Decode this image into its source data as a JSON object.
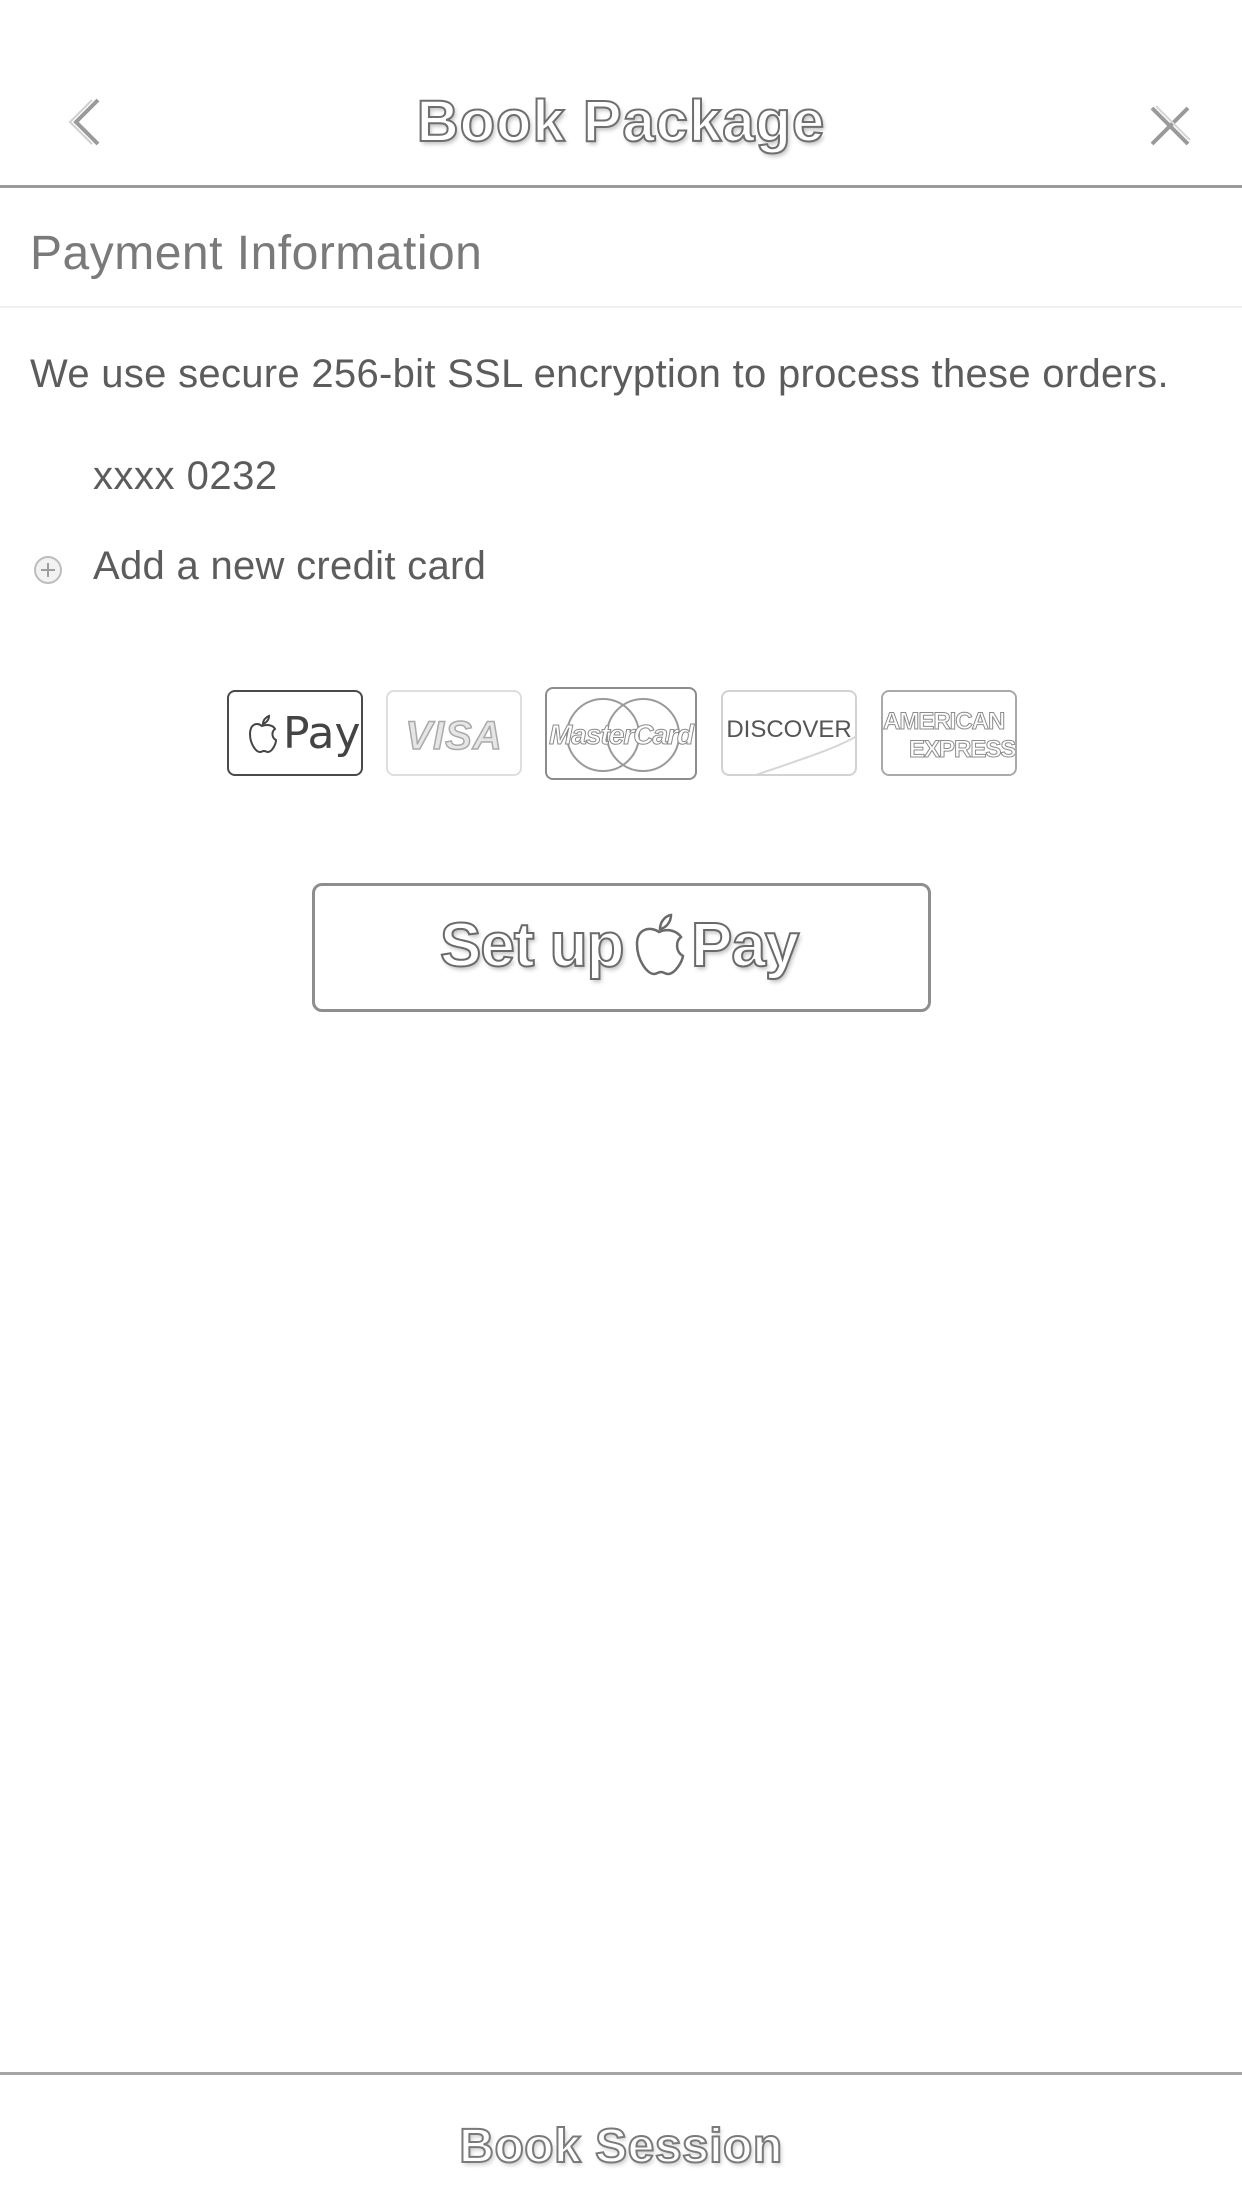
{
  "header": {
    "title": "Book Package",
    "back_icon": "chevron-left-icon",
    "close_icon": "close-icon"
  },
  "payment": {
    "section_title": "Payment Information",
    "ssl_note": "We use secure 256-bit SSL encryption to process these orders.",
    "saved_card": "xxxx 0232",
    "add_card_label": "Add a new credit card",
    "add_card_icon": "plus-circle-icon"
  },
  "card_logos": {
    "apple_pay": "Pay",
    "visa": "VISA",
    "mastercard": "MasterCard",
    "discover": "DISCOVER",
    "amex_line1": "AMERICAN",
    "amex_line2": "EXPRESS"
  },
  "setup_apple_pay": {
    "prefix": "Set up",
    "suffix": "Pay"
  },
  "footer": {
    "book_session": "Book Session"
  },
  "colors": {
    "text": "#5c5c5c",
    "divider": "#9a9a9a",
    "button_border": "#8e8e8e"
  }
}
